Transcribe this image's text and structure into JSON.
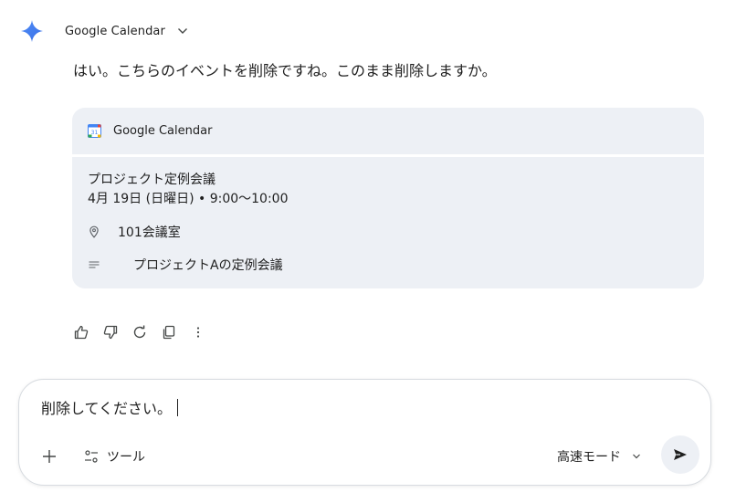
{
  "header": {
    "title": "Google Calendar",
    "icon": "gemini-sparkle-icon"
  },
  "response": {
    "text": "はい。こちらのイベントを削除ですね。このまま削除しますか。"
  },
  "card": {
    "source_label": "Google Calendar",
    "calendar_icon_day": "31",
    "event": {
      "title": "プロジェクト定例会議",
      "datetime": "4月 19日 (日曜日) • 9:00〜10:00",
      "location": "101会議室",
      "description": "プロジェクトAの定例会議"
    }
  },
  "actions": [
    {
      "name": "thumbs-up-icon"
    },
    {
      "name": "thumbs-down-icon"
    },
    {
      "name": "regenerate-icon"
    },
    {
      "name": "copy-icon"
    },
    {
      "name": "more-vert-icon"
    }
  ],
  "input": {
    "value": "削除してください。",
    "tools_label": "ツール",
    "mode_label": "高速モード"
  },
  "colors": {
    "card_bg": "#edf0f5",
    "text": "#1f1f1f",
    "gemini_blue": "#4285f4"
  }
}
